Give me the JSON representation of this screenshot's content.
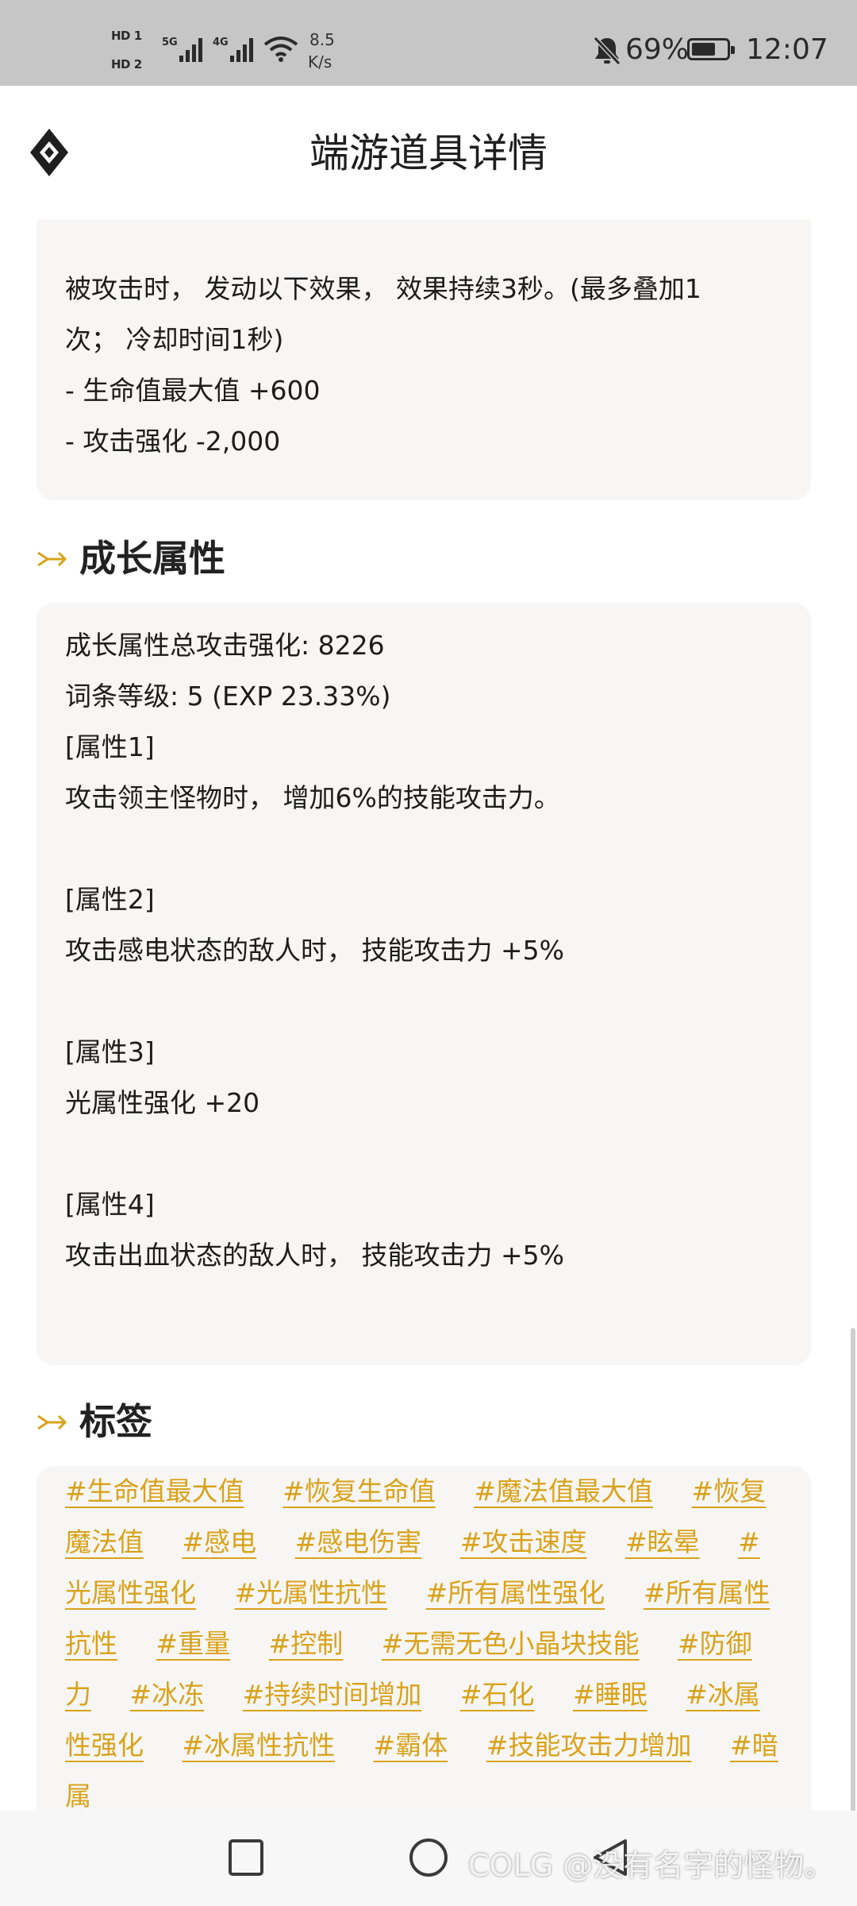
{
  "status_bar": {
    "sim1": "HD 1",
    "sim2": "HD 2",
    "net1": "5G",
    "net2": "4G",
    "speed_value": "8.5",
    "speed_unit": "K/s",
    "battery": "69%",
    "battery_level": 0.69,
    "time": "12:07"
  },
  "header": {
    "title": "端游道具详情"
  },
  "effect_card": {
    "lines": [
      "被攻击时， 发动以下效果， 效果持续3秒。(最多叠加1",
      "次； 冷却时间1秒)",
      "- 生命值最大值 +600",
      "- 攻击强化 -2,000"
    ]
  },
  "growth_section": {
    "title": "成长属性",
    "lines": [
      "成长属性总攻击强化: 8226",
      "词条等级: 5 (EXP 23.33%)",
      "[属性1]",
      "攻击领主怪物时， 增加6%的技能攻击力。",
      "",
      "[属性2]",
      "攻击感电状态的敌人时， 技能攻击力 +5%",
      "",
      "[属性3]",
      "光属性强化 +20",
      "",
      "[属性4]",
      "攻击出血状态的敌人时， 技能攻击力 +5%"
    ]
  },
  "tags_section": {
    "title": "标签",
    "tags": [
      "#生命值最大值",
      "#恢复生命值",
      "#魔法值最大值",
      "#恢复魔法值",
      "#感电",
      "#感电伤害",
      "#攻击速度",
      "#眩晕",
      "#光属性强化",
      "#光属性抗性",
      "#所有属性强化",
      "#所有属性抗性",
      "#重量",
      "#控制",
      "#无需无色小晶块技能",
      "#防御力",
      "#冰冻",
      "#持续时间增加",
      "#石化",
      "#睡眠",
      "#冰属性强化",
      "#冰属性抗性",
      "#霸体",
      "#技能攻击力增加",
      "#暗属"
    ]
  },
  "watermark": "COLG @没有名字的怪物。",
  "colors": {
    "accent": "#d9a21a",
    "card_bg": "#f7f6f4",
    "status_bar_bg": "#c6c6c6"
  },
  "icons": {
    "logo": "diamond-logo-icon",
    "section_marker": "arrow-marker-icon",
    "nav_recents": "square-icon",
    "nav_home": "circle-icon",
    "nav_back": "triangle-back-icon"
  }
}
